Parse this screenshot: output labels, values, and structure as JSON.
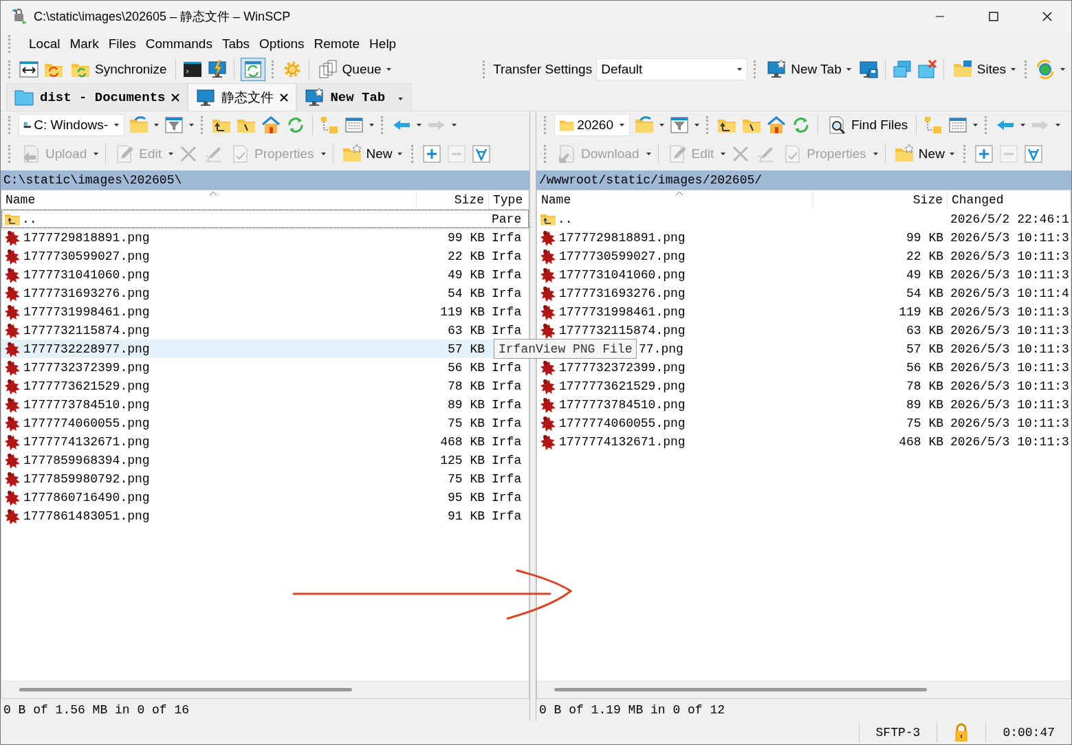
{
  "window": {
    "title": "C:\\static\\images\\202605 – 静态文件 – WinSCP"
  },
  "menu": [
    "Local",
    "Mark",
    "Files",
    "Commands",
    "Tabs",
    "Options",
    "Remote",
    "Help"
  ],
  "toolbar": {
    "synchronize": "Synchronize",
    "queue": "Queue",
    "transfer_settings_label": "Transfer Settings",
    "transfer_settings_value": "Default",
    "new_tab": "New Tab",
    "sites": "Sites"
  },
  "session_tabs": [
    {
      "label": "dist - Documents",
      "selected": false
    },
    {
      "label": "静态文件",
      "selected": true
    },
    {
      "label": "New Tab",
      "selected": false
    }
  ],
  "local": {
    "drive": "C: Windows-",
    "buttons": [
      {
        "label": "Upload",
        "disabled": true
      },
      {
        "label": "Edit",
        "disabled": true
      },
      {
        "label": "Properties",
        "disabled": true
      },
      {
        "label": "New",
        "disabled": false
      }
    ],
    "path": "C:\\static\\images\\202605\\",
    "columns": [
      "Name",
      "Size",
      "Type"
    ],
    "rows": [
      {
        "kind": "parent",
        "name": "..",
        "size": "",
        "type": "Pare",
        "selected": false
      },
      {
        "kind": "file",
        "name": "1777729818891.png",
        "size": "99 KB",
        "type": "Irfa",
        "selected": false
      },
      {
        "kind": "file",
        "name": "1777730599027.png",
        "size": "22 KB",
        "type": "Irfa",
        "selected": false
      },
      {
        "kind": "file",
        "name": "1777731041060.png",
        "size": "49 KB",
        "type": "Irfa",
        "selected": false
      },
      {
        "kind": "file",
        "name": "1777731693276.png",
        "size": "54 KB",
        "type": "Irfa",
        "selected": false
      },
      {
        "kind": "file",
        "name": "1777731998461.png",
        "size": "119 KB",
        "type": "Irfa",
        "selected": false
      },
      {
        "kind": "file",
        "name": "1777732115874.png",
        "size": "63 KB",
        "type": "Irfa",
        "selected": false
      },
      {
        "kind": "file",
        "name": "1777732228977.png",
        "size": "57 KB",
        "type": "",
        "selected": true,
        "tooltip": "IrfanView PNG File"
      },
      {
        "kind": "file",
        "name": "1777732372399.png",
        "size": "56 KB",
        "type": "Irfa",
        "selected": false
      },
      {
        "kind": "file",
        "name": "1777773621529.png",
        "size": "78 KB",
        "type": "Irfa",
        "selected": false
      },
      {
        "kind": "file",
        "name": "1777773784510.png",
        "size": "89 KB",
        "type": "Irfa",
        "selected": false
      },
      {
        "kind": "file",
        "name": "1777774060055.png",
        "size": "75 KB",
        "type": "Irfa",
        "selected": false
      },
      {
        "kind": "file",
        "name": "1777774132671.png",
        "size": "468 KB",
        "type": "Irfa",
        "selected": false
      },
      {
        "kind": "file",
        "name": "1777859968394.png",
        "size": "125 KB",
        "type": "Irfa",
        "selected": false
      },
      {
        "kind": "file",
        "name": "1777859980792.png",
        "size": "75 KB",
        "type": "Irfa",
        "selected": false
      },
      {
        "kind": "file",
        "name": "1777860716490.png",
        "size": "95 KB",
        "type": "Irfa",
        "selected": false
      },
      {
        "kind": "file",
        "name": "1777861483051.png",
        "size": "91 KB",
        "type": "Irfa",
        "selected": false
      }
    ],
    "status": "0 B of 1.56 MB in 0 of 16"
  },
  "remote": {
    "folder": "20260",
    "find_files": "Find Files",
    "buttons": [
      {
        "label": "Download",
        "disabled": true
      },
      {
        "label": "Edit",
        "disabled": true
      },
      {
        "label": "Properties",
        "disabled": true
      },
      {
        "label": "New",
        "disabled": false
      }
    ],
    "path": "/wwwroot/static/images/202605/",
    "columns": [
      "Name",
      "Size",
      "Changed"
    ],
    "rows": [
      {
        "kind": "parent",
        "name": "..",
        "size": "",
        "changed": "2026/5/2 22:46:1",
        "covered": false
      },
      {
        "kind": "file",
        "name": "1777729818891.png",
        "size": "99 KB",
        "changed": "2026/5/3 10:11:3",
        "covered": false
      },
      {
        "kind": "file",
        "name": "1777730599027.png",
        "size": "22 KB",
        "changed": "2026/5/3 10:11:3",
        "covered": false
      },
      {
        "kind": "file",
        "name": "1777731041060.png",
        "size": "49 KB",
        "changed": "2026/5/3 10:11:3",
        "covered": false
      },
      {
        "kind": "file",
        "name": "1777731693276.png",
        "size": "54 KB",
        "changed": "2026/5/3 10:11:4",
        "covered": false
      },
      {
        "kind": "file",
        "name": "1777731998461.png",
        "size": "119 KB",
        "changed": "2026/5/3 10:11:3",
        "covered": false
      },
      {
        "kind": "file",
        "name": "1777732115874.png",
        "size": "63 KB",
        "changed": "2026/5/3 10:11:3",
        "covered": false
      },
      {
        "name": "77.png",
        "size": "57 KB",
        "changed": "2026/5/3 10:11:3",
        "covered": true
      },
      {
        "kind": "file",
        "name": "1777732372399.png",
        "size": "56 KB",
        "changed": "2026/5/3 10:11:3",
        "covered": false
      },
      {
        "kind": "file",
        "name": "1777773621529.png",
        "size": "78 KB",
        "changed": "2026/5/3 10:11:3",
        "covered": false
      },
      {
        "kind": "file",
        "name": "1777773784510.png",
        "size": "89 KB",
        "changed": "2026/5/3 10:11:3",
        "covered": false
      },
      {
        "kind": "file",
        "name": "1777774060055.png",
        "size": "75 KB",
        "changed": "2026/5/3 10:11:3",
        "covered": false
      },
      {
        "kind": "file",
        "name": "1777774132671.png",
        "size": "468 KB",
        "changed": "2026/5/3 10:11:3",
        "covered": false
      }
    ],
    "status": "0 B of 1.19 MB in 0 of 12"
  },
  "status_bar": {
    "protocol": "SFTP-3",
    "elapsed": "0:00:47"
  }
}
